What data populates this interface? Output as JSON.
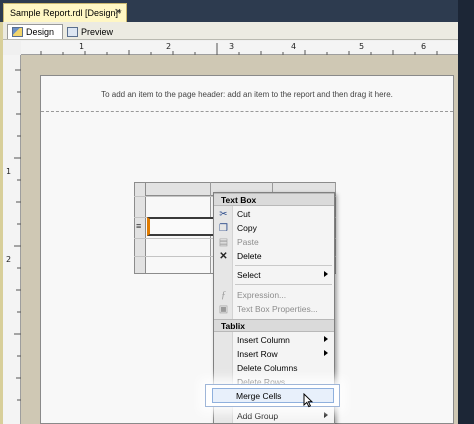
{
  "document_tab": {
    "title": "Sample Report.rdl [Design]*",
    "close": "×"
  },
  "design_tabs": [
    {
      "label": "Design",
      "active": true
    },
    {
      "label": "Preview",
      "active": false
    }
  ],
  "ruler": {
    "h_numbers": [
      "1",
      "2",
      "3",
      "4",
      "5",
      "6"
    ],
    "v_numbers": [
      "1",
      "2"
    ]
  },
  "report": {
    "header_hint": "To add an item to the page header: add an item to the report and then drag it here."
  },
  "context_menu": {
    "text_box_header": "Text Box",
    "items1": [
      {
        "label": "Cut",
        "icon": "scissors-icon",
        "disabled": false
      },
      {
        "label": "Copy",
        "icon": "copy-icon",
        "disabled": false
      },
      {
        "label": "Paste",
        "icon": "paste-icon",
        "disabled": true
      },
      {
        "label": "Delete",
        "icon": "delete-icon",
        "disabled": false
      }
    ],
    "select": "Select",
    "expression": "Expression...",
    "text_box_properties": "Text Box Properties...",
    "tablix_header": "Tablix",
    "tablix_items": [
      {
        "label": "Insert Column",
        "submenu": true
      },
      {
        "label": "Insert Row",
        "submenu": true
      },
      {
        "label": "Delete Columns",
        "submenu": false
      },
      {
        "label": "Delete Rows",
        "submenu": false
      }
    ],
    "merge_cells": "Merge Cells",
    "add_group": "Add Group"
  }
}
